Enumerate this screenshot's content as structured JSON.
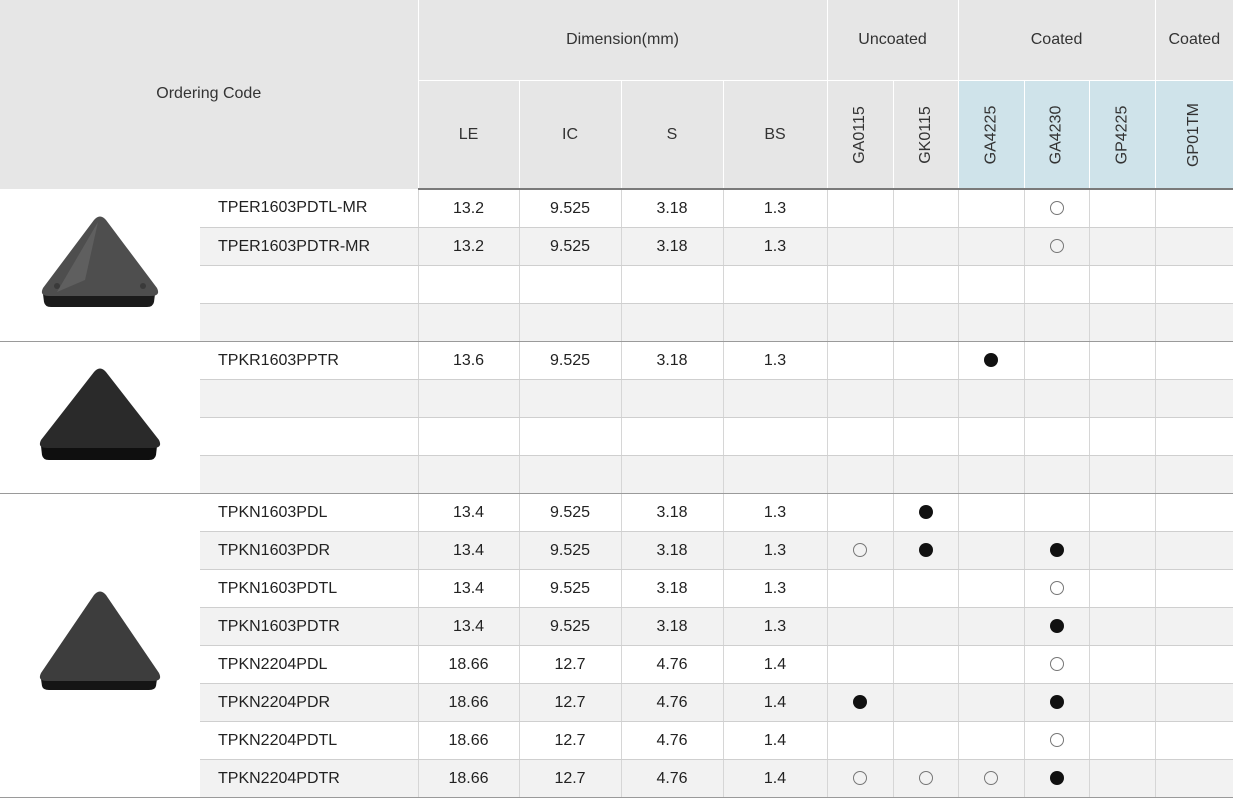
{
  "header": {
    "ordering_code": "Ordering Code",
    "dimension": "Dimension(mm)",
    "uncoated": "Uncoated",
    "coated_1": "Coated",
    "coated_2": "Coated",
    "columns": [
      "LE",
      "IC",
      "S",
      "BS"
    ],
    "grades": [
      "GA0115",
      "GK0115",
      "GA4225",
      "GA4230",
      "GP4225",
      "GP01TM"
    ]
  },
  "legend": {
    "filled": "●",
    "open": "○"
  },
  "colors": {
    "header_gray": "#e6e6e6",
    "header_blue": "#cfe3ea",
    "row_shade": "#f2f2f2"
  },
  "groups": [
    {
      "image": "insert-triangle-gray-image",
      "rows": [
        {
          "code": "TPER1603PDTL-MR",
          "le": "13.2",
          "ic": "9.525",
          "s": "3.18",
          "bs": "1.3",
          "grades": [
            "",
            "",
            "",
            "open",
            "",
            ""
          ]
        },
        {
          "code": "TPER1603PDTR-MR",
          "le": "13.2",
          "ic": "9.525",
          "s": "3.18",
          "bs": "1.3",
          "grades": [
            "",
            "",
            "",
            "open",
            "",
            ""
          ]
        },
        {
          "code": "",
          "le": "",
          "ic": "",
          "s": "",
          "bs": "",
          "grades": [
            "",
            "",
            "",
            "",
            "",
            ""
          ]
        },
        {
          "code": "",
          "le": "",
          "ic": "",
          "s": "",
          "bs": "",
          "grades": [
            "",
            "",
            "",
            "",
            "",
            ""
          ]
        }
      ]
    },
    {
      "image": "insert-triangle-black-image",
      "rows": [
        {
          "code": "TPKR1603PPTR",
          "le": "13.6",
          "ic": "9.525",
          "s": "3.18",
          "bs": "1.3",
          "grades": [
            "",
            "",
            "filled",
            "",
            "",
            ""
          ]
        },
        {
          "code": "",
          "le": "",
          "ic": "",
          "s": "",
          "bs": "",
          "grades": [
            "",
            "",
            "",
            "",
            "",
            ""
          ]
        },
        {
          "code": "",
          "le": "",
          "ic": "",
          "s": "",
          "bs": "",
          "grades": [
            "",
            "",
            "",
            "",
            "",
            ""
          ]
        },
        {
          "code": "",
          "le": "",
          "ic": "",
          "s": "",
          "bs": "",
          "grades": [
            "",
            "",
            "",
            "",
            "",
            ""
          ]
        }
      ]
    },
    {
      "image": "insert-triangle-dark-image",
      "rows": [
        {
          "code": "TPKN1603PDL",
          "le": "13.4",
          "ic": "9.525",
          "s": "3.18",
          "bs": "1.3",
          "grades": [
            "",
            "filled",
            "",
            "",
            "",
            ""
          ]
        },
        {
          "code": "TPKN1603PDR",
          "le": "13.4",
          "ic": "9.525",
          "s": "3.18",
          "bs": "1.3",
          "grades": [
            "open",
            "filled",
            "",
            "filled",
            "",
            ""
          ]
        },
        {
          "code": "TPKN1603PDTL",
          "le": "13.4",
          "ic": "9.525",
          "s": "3.18",
          "bs": "1.3",
          "grades": [
            "",
            "",
            "",
            "open",
            "",
            ""
          ]
        },
        {
          "code": "TPKN1603PDTR",
          "le": "13.4",
          "ic": "9.525",
          "s": "3.18",
          "bs": "1.3",
          "grades": [
            "",
            "",
            "",
            "filled",
            "",
            ""
          ]
        },
        {
          "code": "TPKN2204PDL",
          "le": "18.66",
          "ic": "12.7",
          "s": "4.76",
          "bs": "1.4",
          "grades": [
            "",
            "",
            "",
            "open",
            "",
            ""
          ]
        },
        {
          "code": "TPKN2204PDR",
          "le": "18.66",
          "ic": "12.7",
          "s": "4.76",
          "bs": "1.4",
          "grades": [
            "filled",
            "",
            "",
            "filled",
            "",
            ""
          ]
        },
        {
          "code": "TPKN2204PDTL",
          "le": "18.66",
          "ic": "12.7",
          "s": "4.76",
          "bs": "1.4",
          "grades": [
            "",
            "",
            "",
            "open",
            "",
            ""
          ]
        },
        {
          "code": "TPKN2204PDTR",
          "le": "18.66",
          "ic": "12.7",
          "s": "4.76",
          "bs": "1.4",
          "grades": [
            "open",
            "open",
            "open",
            "filled",
            "",
            ""
          ]
        }
      ]
    }
  ]
}
